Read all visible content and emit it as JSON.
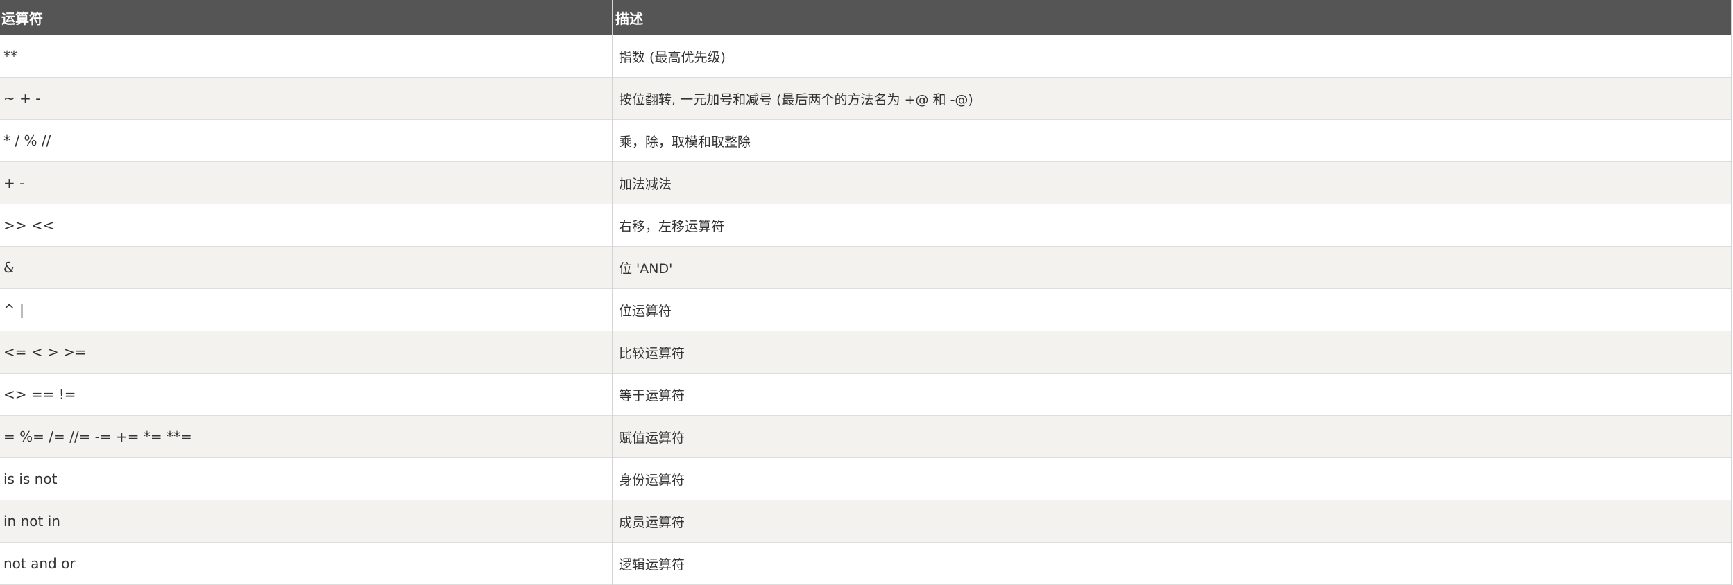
{
  "table": {
    "headers": [
      "运算符",
      "描述"
    ],
    "rows": [
      {
        "operator": "**",
        "description": "指数 (最高优先级)"
      },
      {
        "operator": "~ + -",
        "description": "按位翻转, 一元加号和减号 (最后两个的方法名为 +@ 和 -@)"
      },
      {
        "operator": "* / % //",
        "description": "乘，除，取模和取整除"
      },
      {
        "operator": "+ -",
        "description": "加法减法"
      },
      {
        "operator": ">> <<",
        "description": "右移，左移运算符"
      },
      {
        "operator": "&",
        "description": "位 'AND'"
      },
      {
        "operator": "^ |",
        "description": "位运算符"
      },
      {
        "operator": "<= < > >=",
        "description": "比较运算符"
      },
      {
        "operator": "<> == !=",
        "description": "等于运算符"
      },
      {
        "operator": "= %= /= //= -= += *= **=",
        "description": "赋值运算符"
      },
      {
        "operator": "is is not",
        "description": "身份运算符"
      },
      {
        "operator": "in not in",
        "description": "成员运算符"
      },
      {
        "operator": "not and or",
        "description": "逻辑运算符"
      }
    ]
  },
  "colors": {
    "header_bg": "#555555",
    "header_text": "#ffffff",
    "row_alt_bg": "#f3f2ee",
    "row_bg": "#ffffff",
    "cell_text": "#333333"
  }
}
